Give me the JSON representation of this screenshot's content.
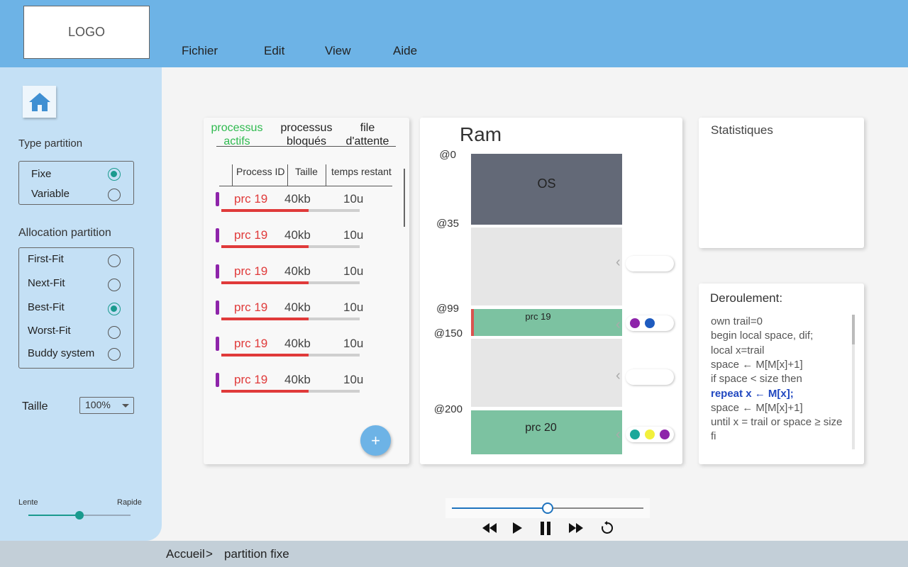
{
  "header": {
    "logo": "LOGO",
    "menu": [
      "Fichier",
      "Edit",
      "View",
      "Aide"
    ]
  },
  "sidebar": {
    "type_partition": {
      "label": "Type partition",
      "options": [
        {
          "label": "Fixe",
          "selected": true
        },
        {
          "label": "Variable",
          "selected": false
        }
      ]
    },
    "allocation": {
      "label": "Allocation partition",
      "options": [
        {
          "label": "First-Fit",
          "selected": false
        },
        {
          "label": "Next-Fit",
          "selected": false
        },
        {
          "label": "Best-Fit",
          "selected": true
        },
        {
          "label": "Worst-Fit",
          "selected": false
        },
        {
          "label": "Buddy system",
          "selected": false
        }
      ]
    },
    "taille": {
      "label": "Taille",
      "value": "100%"
    },
    "speed": {
      "slow_label": "Lente",
      "fast_label": "Rapide",
      "level": 0.5
    }
  },
  "processes": {
    "tabs": [
      {
        "line1": "processus",
        "line2": "actifs",
        "active": true
      },
      {
        "line1": "processus",
        "line2": "bloqués",
        "active": false
      },
      {
        "line1": "file",
        "line2": "d'attente",
        "active": false
      }
    ],
    "columns": [
      "Process ID",
      "Taille",
      "temps restant"
    ],
    "rows": [
      {
        "id": "prc 19",
        "size": "40kb",
        "time": "10u",
        "progress": 0.63
      },
      {
        "id": "prc 19",
        "size": "40kb",
        "time": "10u",
        "progress": 0.63
      },
      {
        "id": "prc 19",
        "size": "40kb",
        "time": "10u",
        "progress": 0.63
      },
      {
        "id": "prc 19",
        "size": "40kb",
        "time": "10u",
        "progress": 0.63
      },
      {
        "id": "prc 19",
        "size": "40kb",
        "time": "10u",
        "progress": 0.63
      },
      {
        "id": "prc 19",
        "size": "40kb",
        "time": "10u",
        "progress": 0.63
      }
    ],
    "add_button": "+"
  },
  "ram": {
    "title": "Ram",
    "addresses": [
      "@0",
      "@35",
      "@99",
      "@150",
      "@200"
    ],
    "blocks": [
      {
        "label": "OS",
        "color": "#636977"
      },
      {
        "label": "",
        "color": "#e6e6e6"
      },
      {
        "label": "prc 19",
        "color": "#7cc2a1"
      },
      {
        "label": "",
        "color": "#e6e6e6"
      },
      {
        "label": "prc 20",
        "color": "#7cc2a1"
      }
    ],
    "pills": [
      {
        "dots": []
      },
      {
        "dots": [
          "#8e24aa",
          "#1e5bbf"
        ]
      },
      {
        "dots": []
      },
      {
        "dots": [
          "#1aa89a",
          "#f2f03c",
          "#8e24aa"
        ]
      }
    ]
  },
  "stats": {
    "title": "Statistiques"
  },
  "deroulement": {
    "title": "Deroulement:",
    "lines": [
      {
        "text": "own trail=0",
        "highlight": false
      },
      {
        "text": "begin local space, dif;",
        "highlight": false
      },
      {
        "text": "local x=trail",
        "highlight": false
      },
      {
        "text": "space ← M[M[x]+1]",
        "highlight": false
      },
      {
        "text": "if space < size then",
        "highlight": false
      },
      {
        "text": "repeat x ← M[x];",
        "highlight": true
      },
      {
        "text": "space ← M[M[x]+1]",
        "highlight": false
      },
      {
        "text": "until x = trail or space ≥ size",
        "highlight": false
      },
      {
        "text": "fi",
        "highlight": false
      }
    ]
  },
  "player": {
    "progress": 0.5
  },
  "breadcrumb": [
    "Accueil",
    ">",
    "partition fixe"
  ]
}
